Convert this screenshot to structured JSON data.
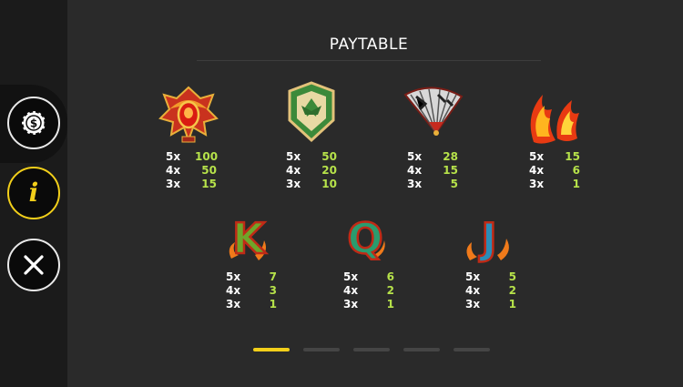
{
  "title": "PAYTABLE",
  "sidebar": {
    "buttons": [
      {
        "icon": "dollar-chip-icon"
      },
      {
        "icon": "info-icon",
        "label": "i"
      },
      {
        "icon": "close-icon"
      }
    ]
  },
  "symbols_row1": [
    {
      "name": "phoenix-emblem",
      "pays": [
        {
          "mult": "5x",
          "value": "100"
        },
        {
          "mult": "4x",
          "value": "50"
        },
        {
          "mult": "3x",
          "value": "15"
        }
      ]
    },
    {
      "name": "green-shield",
      "pays": [
        {
          "mult": "5x",
          "value": "50"
        },
        {
          "mult": "4x",
          "value": "20"
        },
        {
          "mult": "3x",
          "value": "10"
        }
      ]
    },
    {
      "name": "folding-fan",
      "pays": [
        {
          "mult": "5x",
          "value": "28"
        },
        {
          "mult": "4x",
          "value": "15"
        },
        {
          "mult": "3x",
          "value": "5"
        }
      ]
    },
    {
      "name": "fire-feathers",
      "pays": [
        {
          "mult": "5x",
          "value": "15"
        },
        {
          "mult": "4x",
          "value": "6"
        },
        {
          "mult": "3x",
          "value": "1"
        }
      ]
    }
  ],
  "symbols_row2": [
    {
      "name": "letter-k",
      "letter": "K",
      "pays": [
        {
          "mult": "5x",
          "value": "7"
        },
        {
          "mult": "4x",
          "value": "3"
        },
        {
          "mult": "3x",
          "value": "1"
        }
      ]
    },
    {
      "name": "letter-q",
      "letter": "Q",
      "pays": [
        {
          "mult": "5x",
          "value": "6"
        },
        {
          "mult": "4x",
          "value": "2"
        },
        {
          "mult": "3x",
          "value": "1"
        }
      ]
    },
    {
      "name": "letter-j",
      "letter": "J",
      "pays": [
        {
          "mult": "5x",
          "value": "5"
        },
        {
          "mult": "4x",
          "value": "2"
        },
        {
          "mult": "3x",
          "value": "1"
        }
      ]
    }
  ],
  "pagination": {
    "pages": 5,
    "current_page": 1
  },
  "colors": {
    "accent": "#f2cf1a",
    "pay_value": "#b6e24a",
    "background": "#2a2a2a",
    "sidebar": "#1b1b1b"
  }
}
